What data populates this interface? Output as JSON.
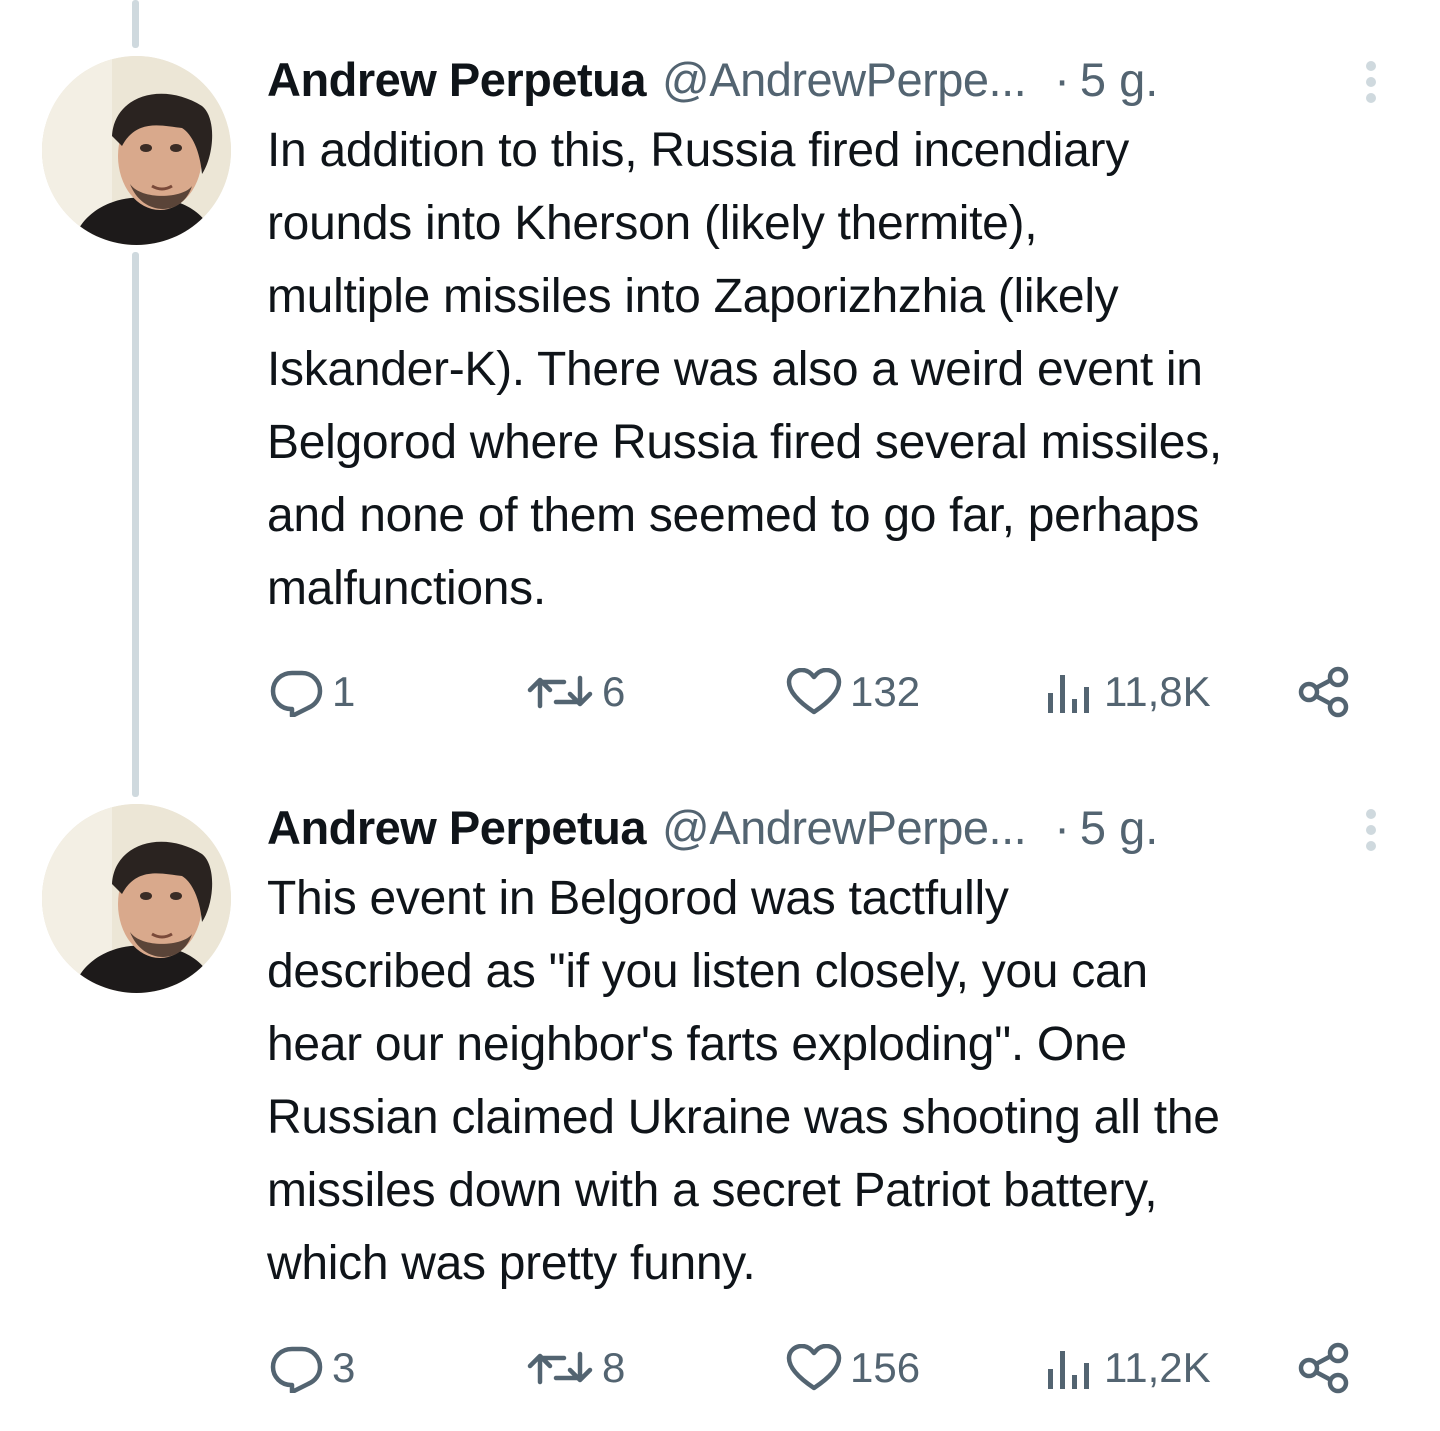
{
  "tweets": [
    {
      "author_name": "Andrew Perpetua",
      "author_handle": "@AndrewPerpe...",
      "separator": "·",
      "time": "5 g.",
      "text": "In addition to this, Russia fired incendiary\nrounds into Kherson (likely thermite),\nmultiple missiles into Zaporizhzhia (likely\nIskander-K). There was also a weird event in\nBelgorod where Russia fired several missiles,\nand none of them seemed to go far, perhaps\nmalfunctions.",
      "replies": "1",
      "retweets": "6",
      "likes": "132",
      "views": "11,8K"
    },
    {
      "author_name": "Andrew Perpetua",
      "author_handle": "@AndrewPerpe...",
      "separator": "·",
      "time": "5 g.",
      "text": "This event in Belgorod was tactfully\ndescribed as \"if you listen closely, you can\nhear our neighbor's farts exploding\". One\nRussian claimed Ukraine was shooting all the\nmissiles down with a secret Patriot battery,\nwhich was pretty funny.",
      "replies": "3",
      "retweets": "8",
      "likes": "156",
      "views": "11,2K"
    }
  ],
  "icons": {
    "reply": "reply-icon",
    "retweet": "retweet-icon",
    "like": "heart-icon",
    "views": "views-icon",
    "share": "share-icon",
    "more": "more-options-icon"
  },
  "colors": {
    "text_primary": "#0f1419",
    "text_secondary": "#536471",
    "thread_line": "#cfd9de"
  }
}
